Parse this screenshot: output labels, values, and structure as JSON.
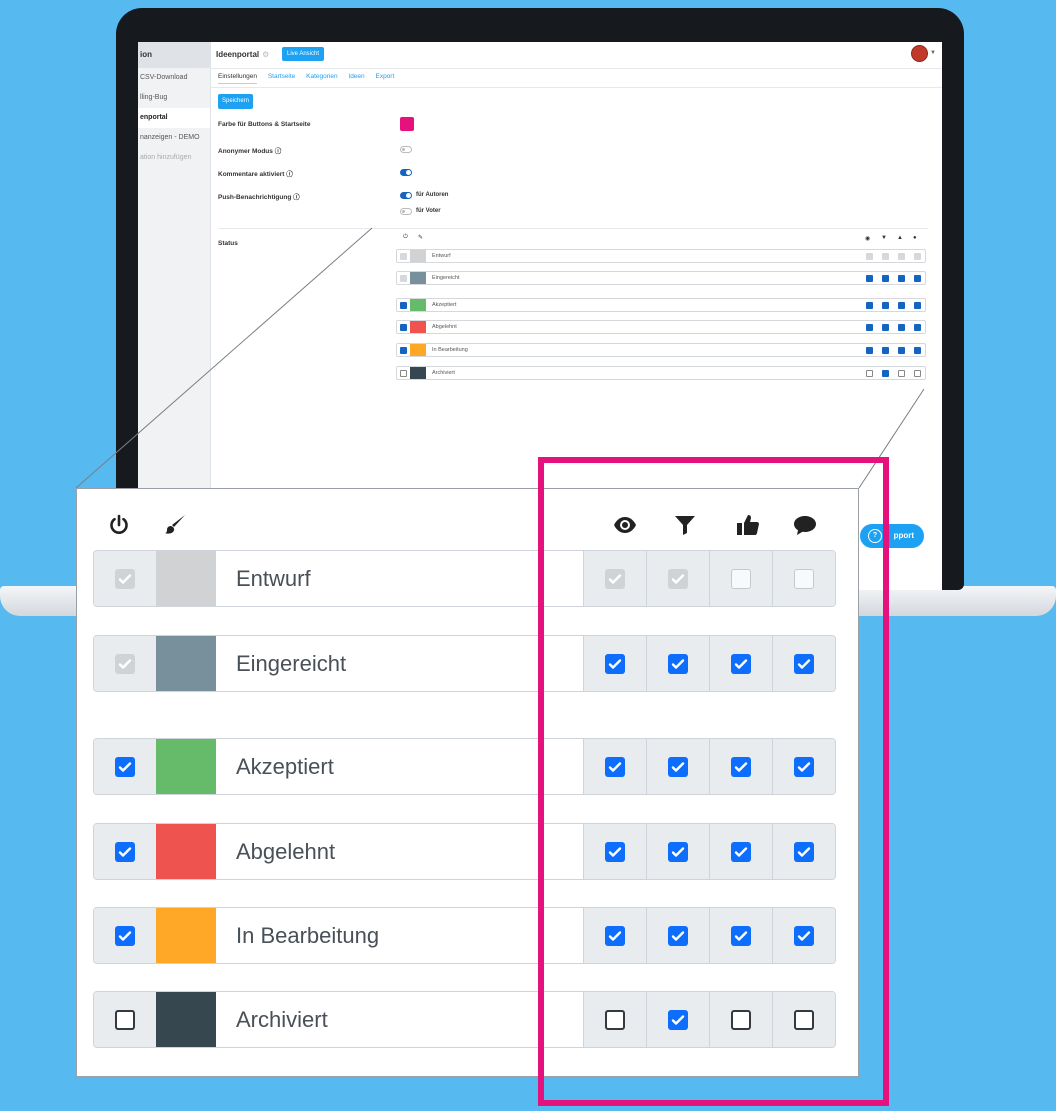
{
  "sidebar": {
    "header": "ion",
    "items": [
      {
        "label": "CSV-Download",
        "state": "normal"
      },
      {
        "label": "lling-Bug",
        "state": "normal"
      },
      {
        "label": "enportal",
        "state": "active"
      },
      {
        "label": "nanzeigen - DEMO",
        "state": "normal"
      },
      {
        "label": "ation hinzufügen",
        "state": "muted"
      }
    ]
  },
  "topbar": {
    "title": "Ideenportal",
    "live_button": "Live Ansicht"
  },
  "tabs": [
    "Einstellungen",
    "Startseite",
    "Kategorien",
    "Ideen",
    "Export"
  ],
  "save_button": "Speichern",
  "settings": {
    "button_color_label": "Farbe für Buttons & Startseite",
    "button_color": "#e5127d",
    "anonymous_label": "Anonymer Modus ⓘ",
    "anonymous_on": false,
    "comments_label": "Kommentare aktiviert ⓘ",
    "comments_on": true,
    "push_label": "Push-Benachrichtigung ⓘ",
    "push_authors_label": "für Autoren",
    "push_authors_on": true,
    "push_voters_label": "für Voter",
    "push_voters_on": false,
    "status_label": "Status"
  },
  "support_button": "pport",
  "columns": [
    "power-icon",
    "brush-icon",
    "eye-icon",
    "filter-icon",
    "thumbs-up-icon",
    "comment-icon"
  ],
  "statuses": [
    {
      "name": "Entwurf",
      "color": "#d0d2d4",
      "enabled": "disabled-checked",
      "flags": [
        "disabled-checked",
        "disabled-checked",
        "disabled-unchecked",
        "disabled-unchecked"
      ]
    },
    {
      "name": "Eingereicht",
      "color": "#78909c",
      "enabled": "disabled-checked",
      "flags": [
        "checked",
        "checked",
        "checked",
        "checked"
      ]
    },
    {
      "name": "Akzeptiert",
      "color": "#66bb6a",
      "enabled": "checked",
      "flags": [
        "checked",
        "checked",
        "checked",
        "checked"
      ]
    },
    {
      "name": "Abgelehnt",
      "color": "#ef5350",
      "enabled": "checked",
      "flags": [
        "checked",
        "checked",
        "checked",
        "checked"
      ]
    },
    {
      "name": "In Bearbeitung",
      "color": "#ffa726",
      "enabled": "checked",
      "flags": [
        "checked",
        "checked",
        "checked",
        "checked"
      ]
    },
    {
      "name": "Archiviert",
      "color": "#37474f",
      "enabled": "unchecked",
      "flags": [
        "unchecked",
        "checked",
        "unchecked",
        "unchecked"
      ]
    }
  ],
  "colors": {
    "background": "#56b9ef",
    "accent": "#1da1f2",
    "highlight": "#e5127d",
    "checkbox": "#0d6efd"
  }
}
